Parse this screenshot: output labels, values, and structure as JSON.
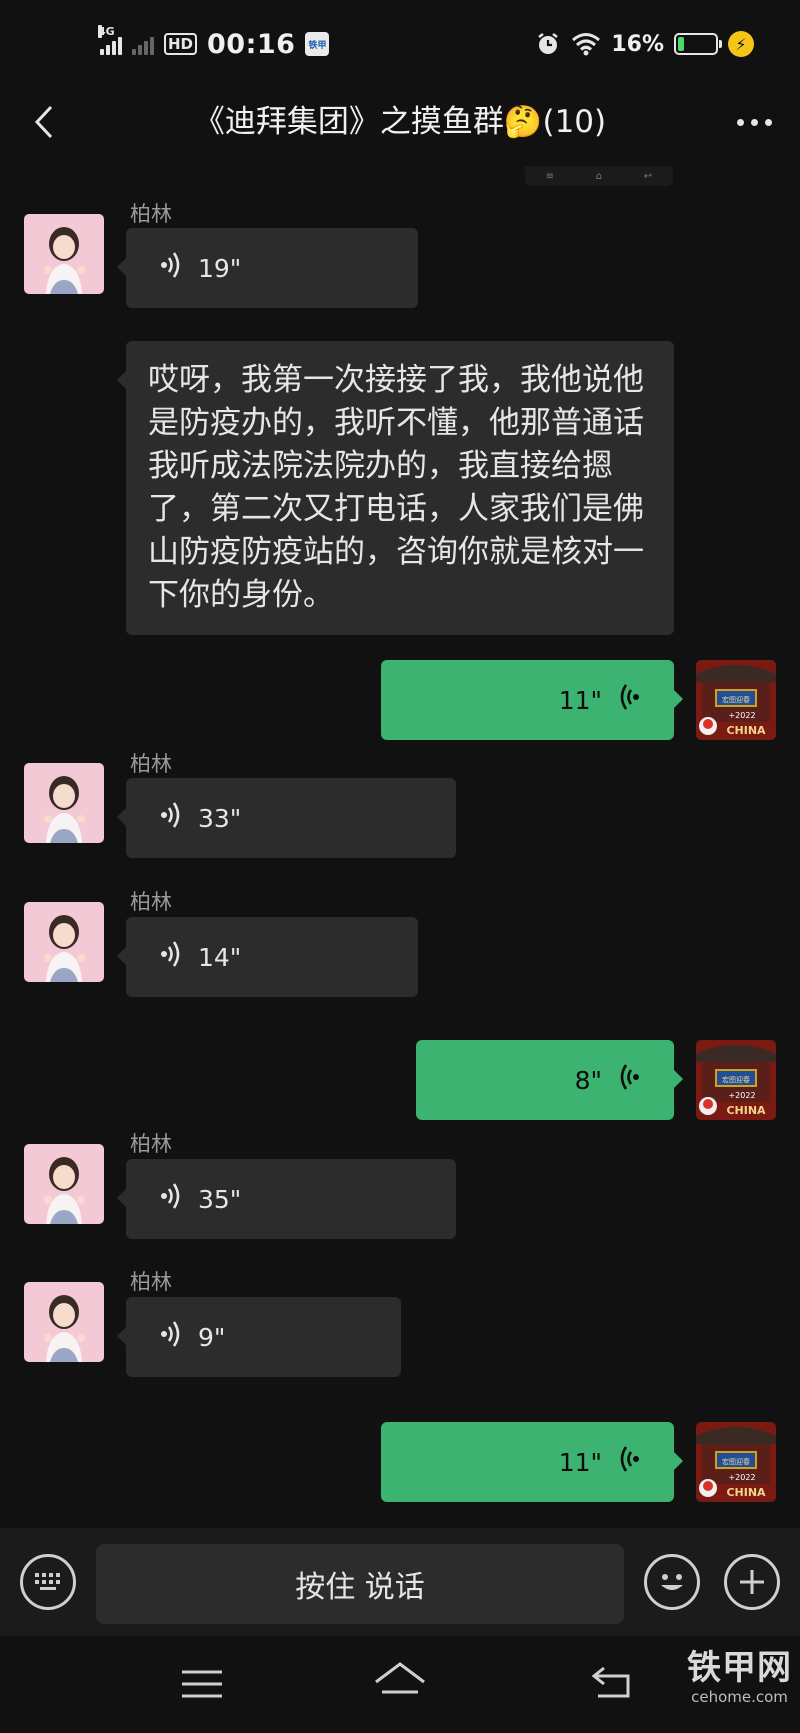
{
  "status_bar": {
    "network": "4G",
    "hd": "HD",
    "time": "00:16",
    "app_badge": "铁甲",
    "battery_percent": "16%",
    "battery_level": 0.16,
    "charging_icon": "⚡"
  },
  "header": {
    "title": "《迪拜集团》之摸鱼群🤔(10)",
    "back_icon": "chevron-left-icon",
    "more_icon": "more-dots-icon"
  },
  "peek": [
    "≡",
    "⌂",
    "↩"
  ],
  "messages": [
    {
      "side": "in",
      "sender": "柏林",
      "type": "voice",
      "duration": "19\""
    },
    {
      "side": "in",
      "type": "text",
      "text": "哎呀，我第一次接接了我，我他说他是防疫办的，我听不懂，他那普通话我听成法院法院办的，我直接给摁了，第二次又打电话，人家我们是佛山防疫防疫站的，咨询你就是核对一下你的身份。"
    },
    {
      "side": "out",
      "type": "voice",
      "duration": "11\""
    },
    {
      "side": "in",
      "sender": "柏林",
      "type": "voice",
      "duration": "33\""
    },
    {
      "side": "in",
      "sender": "柏林",
      "type": "voice",
      "duration": "14\""
    },
    {
      "side": "out",
      "type": "voice",
      "duration": "8\""
    },
    {
      "side": "in",
      "sender": "柏林",
      "type": "voice",
      "duration": "35\""
    },
    {
      "side": "in",
      "sender": "柏林",
      "type": "voice",
      "duration": "9\""
    },
    {
      "side": "out",
      "type": "voice",
      "duration": "11\""
    }
  ],
  "self_avatar": {
    "sign_text": "宏图迎春",
    "year_text": "+2022",
    "brand_text": "CHINA"
  },
  "input_bar": {
    "hold_to_talk": "按住 说话"
  },
  "watermark": {
    "main": "铁甲网",
    "sub": "cehome.com"
  },
  "colors": {
    "background": "#111111",
    "incoming_bubble": "#2c2c2c",
    "outgoing_bubble": "#3cb371"
  }
}
